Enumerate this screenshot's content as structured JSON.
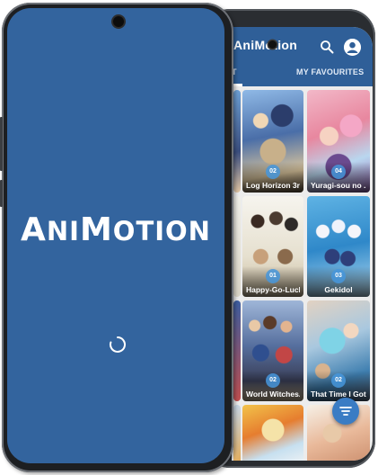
{
  "splash": {
    "logo_parts": [
      "A",
      "NI",
      "M",
      "OTION"
    ]
  },
  "list_screen": {
    "app_title": "AniMotion",
    "tabs": [
      {
        "label": "T"
      },
      {
        "label": "MY FAVOURITES"
      }
    ],
    "cards": [
      {
        "title": "",
        "badge": ""
      },
      {
        "title": "",
        "badge": ""
      },
      {
        "title": "Log Horizon 3r...",
        "badge": "02"
      },
      {
        "title": "Yuragi-sou no ...",
        "badge": "04"
      },
      {
        "title": "",
        "badge": ""
      },
      {
        "title": "",
        "badge": ""
      },
      {
        "title": "Happy-Go-Luck...",
        "badge": "01"
      },
      {
        "title": "Gekidol",
        "badge": "03"
      },
      {
        "title": "",
        "badge": ""
      },
      {
        "title": "",
        "badge": ""
      },
      {
        "title": "World Witches...",
        "badge": "02"
      },
      {
        "title": "That Time I Got...",
        "badge": "02"
      },
      {
        "title": "",
        "badge": ""
      },
      {
        "title": "",
        "badge": ""
      }
    ]
  },
  "colors": {
    "brand_blue": "#33649e",
    "app_bar": "#2f5f98",
    "fab": "#3a7cc4"
  },
  "icons": {
    "search": "search-icon",
    "account": "account-icon",
    "filter": "filter-icon",
    "loading": "loading-spinner-icon"
  }
}
